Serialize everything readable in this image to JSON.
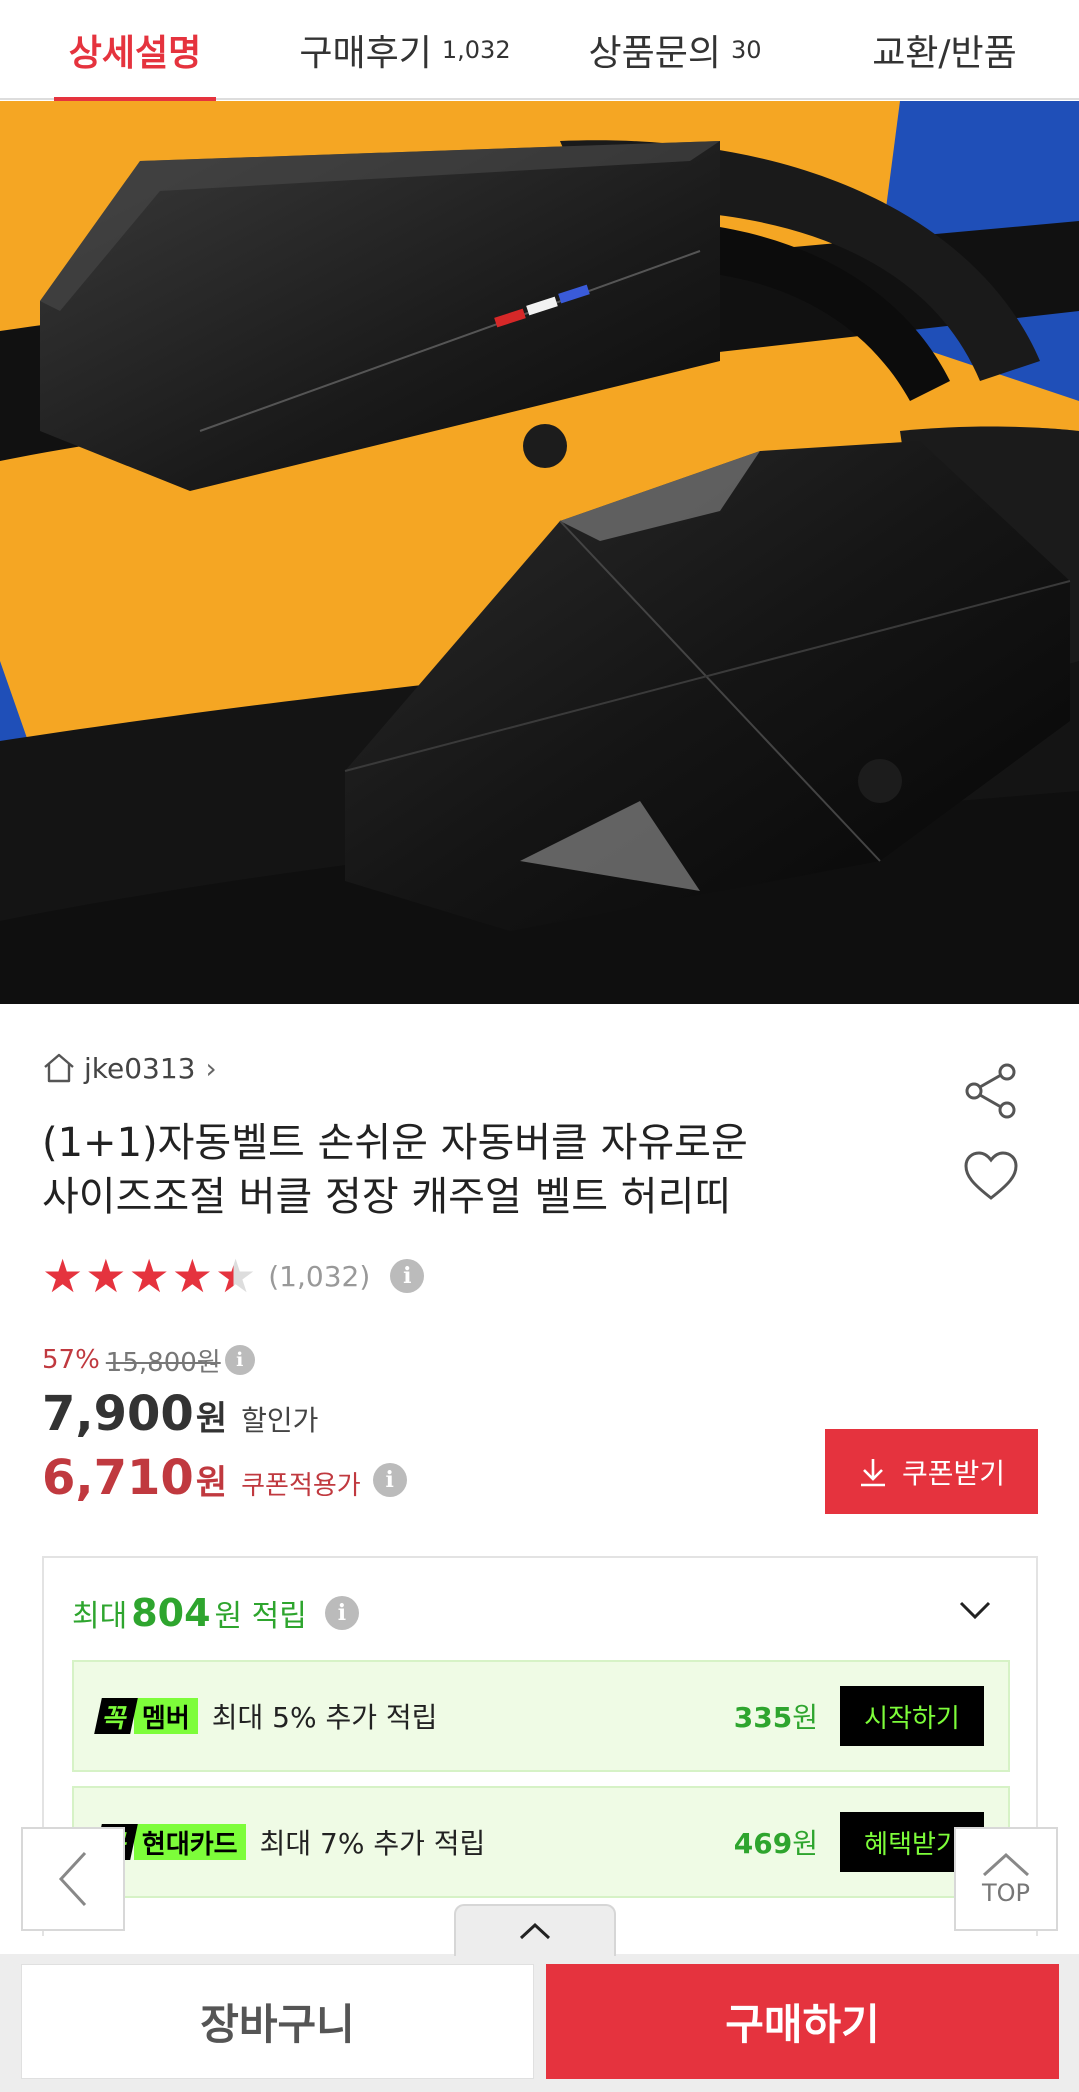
{
  "tabs": [
    {
      "label": "상세설명",
      "count": ""
    },
    {
      "label": "구매후기",
      "count": "1,032"
    },
    {
      "label": "상품문의",
      "count": "30"
    },
    {
      "label": "교환/반품",
      "count": ""
    }
  ],
  "seller": {
    "name": "jke0313"
  },
  "product": {
    "title_line1": "(1+1)자동벨트 손쉬운 자동버클 자유로운",
    "title_line2": "사이즈조절 버클 정장 캐주얼 벨트 허리띠",
    "rating": 4.5,
    "review_count": "(1,032)",
    "discount_pct": "57%",
    "original_price": "15,800원",
    "sale_price": "7,900",
    "sale_unit": "원",
    "sale_label": "할인가",
    "coupon_price": "6,710",
    "coupon_unit": "원",
    "coupon_label": "쿠폰적용가"
  },
  "coupon_button": "쿠폰받기",
  "points": {
    "prefix": "최대",
    "amount": "804",
    "suffix": "원 적립",
    "rows": [
      {
        "badge_k": "꼭",
        "badge_name": "멤버",
        "desc": "최대 5% 추가 적립",
        "amount": "335",
        "unit": "원",
        "action": "시작하기"
      },
      {
        "badge_k": "꼭",
        "badge_name": "현대카드",
        "desc": "최대 7% 추가 적립",
        "amount": "469",
        "unit": "원",
        "action": "혜택받기"
      }
    ]
  },
  "float": {
    "top_label": "TOP"
  },
  "bottom_bar": {
    "cart": "장바구니",
    "buy": "구매하기"
  },
  "colors": {
    "accent": "#e5333e",
    "points_green": "#2ea52e",
    "neon": "#7dfd3a"
  }
}
